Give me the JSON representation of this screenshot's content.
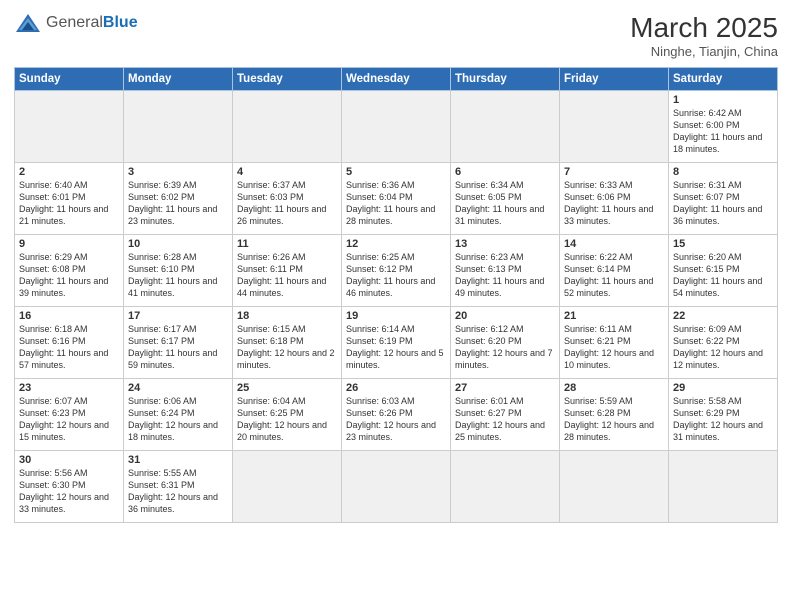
{
  "logo": {
    "text_general": "General",
    "text_blue": "Blue"
  },
  "title": {
    "month_year": "March 2025",
    "location": "Ninghe, Tianjin, China"
  },
  "weekdays": [
    "Sunday",
    "Monday",
    "Tuesday",
    "Wednesday",
    "Thursday",
    "Friday",
    "Saturday"
  ],
  "weeks": [
    [
      {
        "day": "",
        "info": ""
      },
      {
        "day": "",
        "info": ""
      },
      {
        "day": "",
        "info": ""
      },
      {
        "day": "",
        "info": ""
      },
      {
        "day": "",
        "info": ""
      },
      {
        "day": "",
        "info": ""
      },
      {
        "day": "1",
        "info": "Sunrise: 6:42 AM\nSunset: 6:00 PM\nDaylight: 11 hours and 18 minutes."
      }
    ],
    [
      {
        "day": "2",
        "info": "Sunrise: 6:40 AM\nSunset: 6:01 PM\nDaylight: 11 hours and 21 minutes."
      },
      {
        "day": "3",
        "info": "Sunrise: 6:39 AM\nSunset: 6:02 PM\nDaylight: 11 hours and 23 minutes."
      },
      {
        "day": "4",
        "info": "Sunrise: 6:37 AM\nSunset: 6:03 PM\nDaylight: 11 hours and 26 minutes."
      },
      {
        "day": "5",
        "info": "Sunrise: 6:36 AM\nSunset: 6:04 PM\nDaylight: 11 hours and 28 minutes."
      },
      {
        "day": "6",
        "info": "Sunrise: 6:34 AM\nSunset: 6:05 PM\nDaylight: 11 hours and 31 minutes."
      },
      {
        "day": "7",
        "info": "Sunrise: 6:33 AM\nSunset: 6:06 PM\nDaylight: 11 hours and 33 minutes."
      },
      {
        "day": "8",
        "info": "Sunrise: 6:31 AM\nSunset: 6:07 PM\nDaylight: 11 hours and 36 minutes."
      }
    ],
    [
      {
        "day": "9",
        "info": "Sunrise: 6:29 AM\nSunset: 6:08 PM\nDaylight: 11 hours and 39 minutes."
      },
      {
        "day": "10",
        "info": "Sunrise: 6:28 AM\nSunset: 6:10 PM\nDaylight: 11 hours and 41 minutes."
      },
      {
        "day": "11",
        "info": "Sunrise: 6:26 AM\nSunset: 6:11 PM\nDaylight: 11 hours and 44 minutes."
      },
      {
        "day": "12",
        "info": "Sunrise: 6:25 AM\nSunset: 6:12 PM\nDaylight: 11 hours and 46 minutes."
      },
      {
        "day": "13",
        "info": "Sunrise: 6:23 AM\nSunset: 6:13 PM\nDaylight: 11 hours and 49 minutes."
      },
      {
        "day": "14",
        "info": "Sunrise: 6:22 AM\nSunset: 6:14 PM\nDaylight: 11 hours and 52 minutes."
      },
      {
        "day": "15",
        "info": "Sunrise: 6:20 AM\nSunset: 6:15 PM\nDaylight: 11 hours and 54 minutes."
      }
    ],
    [
      {
        "day": "16",
        "info": "Sunrise: 6:18 AM\nSunset: 6:16 PM\nDaylight: 11 hours and 57 minutes."
      },
      {
        "day": "17",
        "info": "Sunrise: 6:17 AM\nSunset: 6:17 PM\nDaylight: 11 hours and 59 minutes."
      },
      {
        "day": "18",
        "info": "Sunrise: 6:15 AM\nSunset: 6:18 PM\nDaylight: 12 hours and 2 minutes."
      },
      {
        "day": "19",
        "info": "Sunrise: 6:14 AM\nSunset: 6:19 PM\nDaylight: 12 hours and 5 minutes."
      },
      {
        "day": "20",
        "info": "Sunrise: 6:12 AM\nSunset: 6:20 PM\nDaylight: 12 hours and 7 minutes."
      },
      {
        "day": "21",
        "info": "Sunrise: 6:11 AM\nSunset: 6:21 PM\nDaylight: 12 hours and 10 minutes."
      },
      {
        "day": "22",
        "info": "Sunrise: 6:09 AM\nSunset: 6:22 PM\nDaylight: 12 hours and 12 minutes."
      }
    ],
    [
      {
        "day": "23",
        "info": "Sunrise: 6:07 AM\nSunset: 6:23 PM\nDaylight: 12 hours and 15 minutes."
      },
      {
        "day": "24",
        "info": "Sunrise: 6:06 AM\nSunset: 6:24 PM\nDaylight: 12 hours and 18 minutes."
      },
      {
        "day": "25",
        "info": "Sunrise: 6:04 AM\nSunset: 6:25 PM\nDaylight: 12 hours and 20 minutes."
      },
      {
        "day": "26",
        "info": "Sunrise: 6:03 AM\nSunset: 6:26 PM\nDaylight: 12 hours and 23 minutes."
      },
      {
        "day": "27",
        "info": "Sunrise: 6:01 AM\nSunset: 6:27 PM\nDaylight: 12 hours and 25 minutes."
      },
      {
        "day": "28",
        "info": "Sunrise: 5:59 AM\nSunset: 6:28 PM\nDaylight: 12 hours and 28 minutes."
      },
      {
        "day": "29",
        "info": "Sunrise: 5:58 AM\nSunset: 6:29 PM\nDaylight: 12 hours and 31 minutes."
      }
    ],
    [
      {
        "day": "30",
        "info": "Sunrise: 5:56 AM\nSunset: 6:30 PM\nDaylight: 12 hours and 33 minutes."
      },
      {
        "day": "31",
        "info": "Sunrise: 5:55 AM\nSunset: 6:31 PM\nDaylight: 12 hours and 36 minutes."
      },
      {
        "day": "",
        "info": ""
      },
      {
        "day": "",
        "info": ""
      },
      {
        "day": "",
        "info": ""
      },
      {
        "day": "",
        "info": ""
      },
      {
        "day": "",
        "info": ""
      }
    ]
  ]
}
